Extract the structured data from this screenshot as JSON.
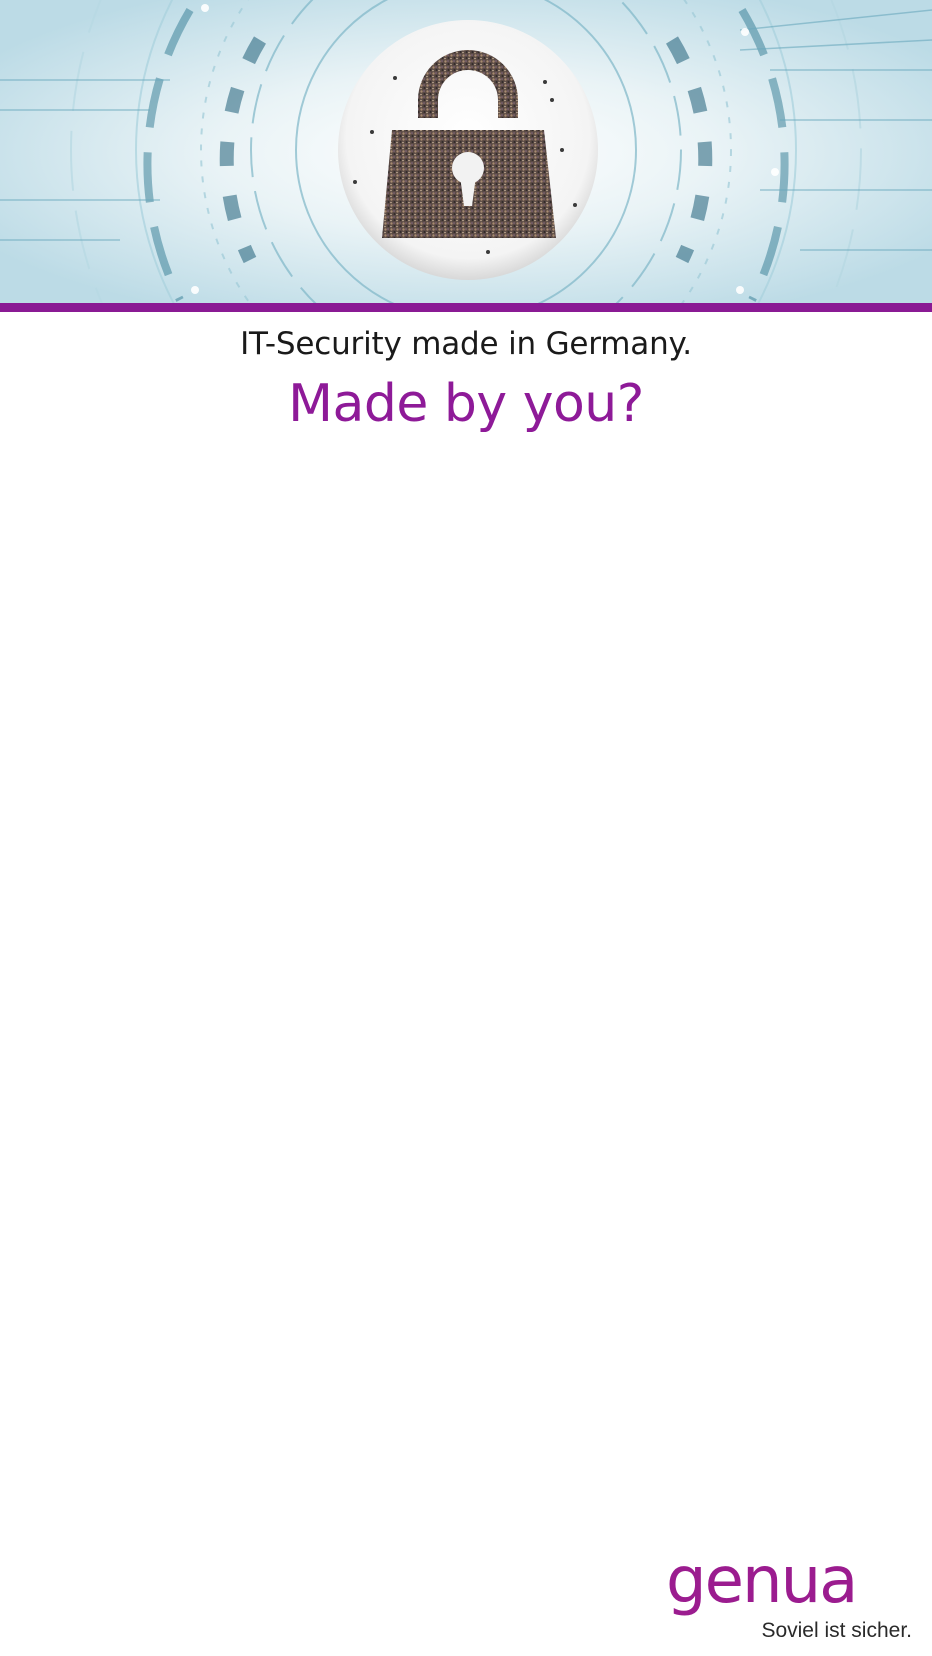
{
  "hero": {
    "image_name": "crowd-padlock-circuit-banner",
    "accent_color": "#8a1a94"
  },
  "headline": "IT-Security made in Germany.",
  "subheadline": "Made by you?",
  "brand": {
    "name": "genua",
    "tagline": "Soviel ist sicher.",
    "color": "#9b1c8f"
  }
}
